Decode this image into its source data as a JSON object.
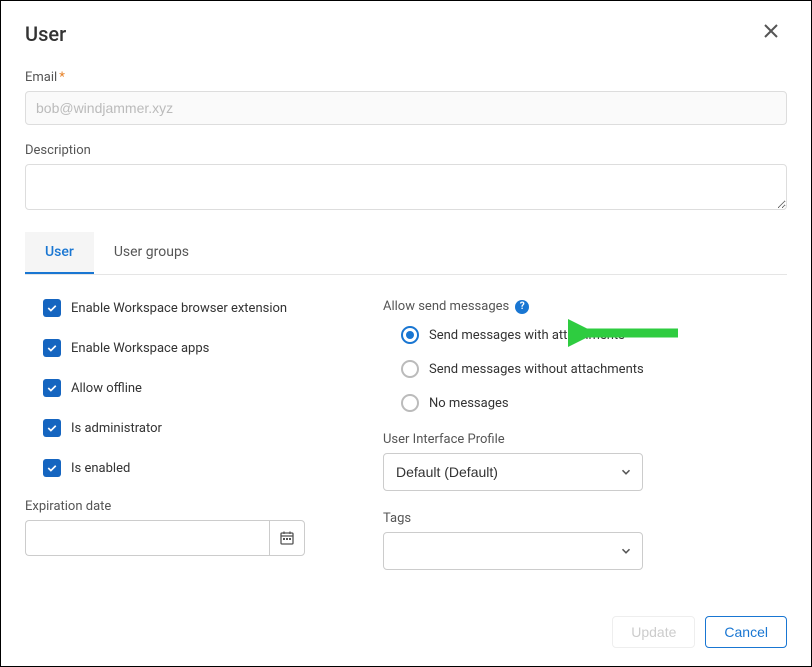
{
  "dialog": {
    "title": "User",
    "close_icon": "close-icon"
  },
  "form": {
    "email_label": "Email",
    "email_value": "bob@windjammer.xyz",
    "description_label": "Description",
    "description_value": "",
    "expiration_label": "Expiration date",
    "expiration_value": ""
  },
  "tabs": {
    "user": "User",
    "user_groups": "User groups",
    "active": "user"
  },
  "checkboxes": [
    {
      "label": "Enable Workspace browser extension",
      "checked": true
    },
    {
      "label": "Enable Workspace apps",
      "checked": true
    },
    {
      "label": "Allow offline",
      "checked": true
    },
    {
      "label": "Is administrator",
      "checked": true
    },
    {
      "label": "Is enabled",
      "checked": true
    }
  ],
  "allow_send": {
    "label": "Allow send messages",
    "options": [
      {
        "label": "Send messages with attachments",
        "selected": true
      },
      {
        "label": "Send messages without attachments",
        "selected": false
      },
      {
        "label": "No messages",
        "selected": false
      }
    ]
  },
  "ui_profile": {
    "label": "User Interface Profile",
    "value": "Default (Default)"
  },
  "tags": {
    "label": "Tags",
    "value": ""
  },
  "footer": {
    "update": "Update",
    "cancel": "Cancel"
  },
  "annotation": {
    "arrow_color": "#2ecc40"
  }
}
